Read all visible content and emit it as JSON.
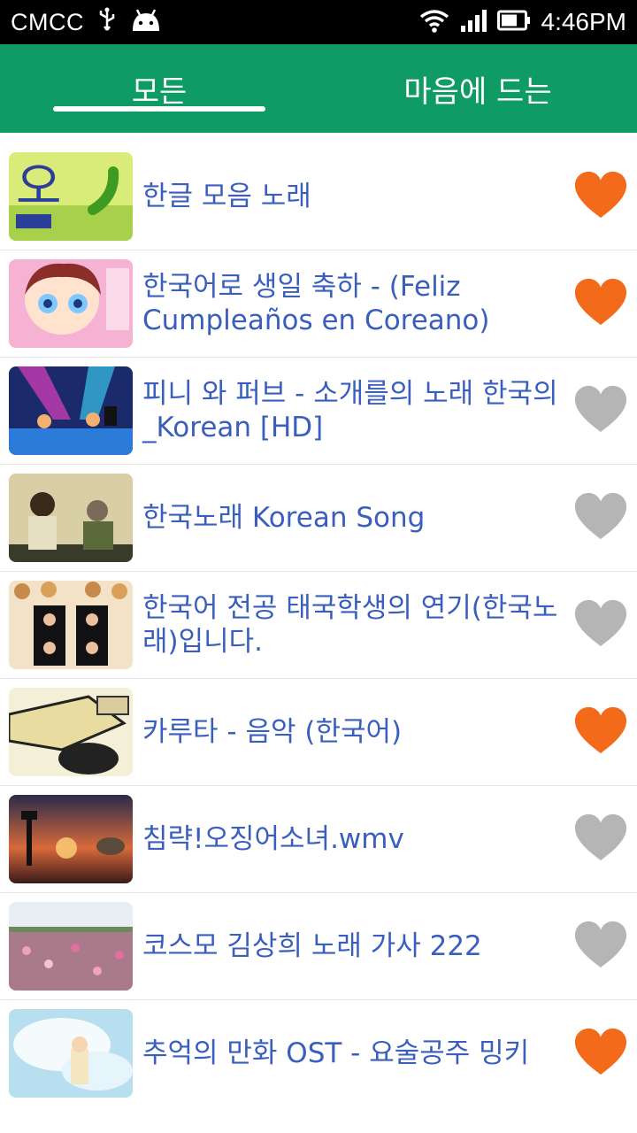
{
  "status_bar": {
    "carrier": "CMCC",
    "time": "4:46PM"
  },
  "tabs": [
    {
      "label": "모든",
      "selected": true
    },
    {
      "label": "마음에 드는",
      "selected": false
    }
  ],
  "colors": {
    "header_green": "#0f9c64",
    "title_blue": "#3a5ebd",
    "heart_favorite": "#f26a1a",
    "heart_default": "#b5b5b5"
  },
  "videos": [
    {
      "title": "한글 모음 노래",
      "favorite": true
    },
    {
      "title": "한국어로 생일 축하 - (Feliz Cumpleaños en Coreano)",
      "favorite": true
    },
    {
      "title": "피니 와 퍼브 - 소개를의 노래 한국의_Korean [HD]",
      "favorite": false
    },
    {
      "title": "한국노래 Korean Song",
      "favorite": false
    },
    {
      "title": "한국어 전공 태국학생의 연기(한국노래)입니다.",
      "favorite": false
    },
    {
      "title": "카루타 - 음악 (한국어)",
      "favorite": true
    },
    {
      "title": "침략!오징어소녀.wmv",
      "favorite": false
    },
    {
      "title": "코스모 김상희 노래 가사 222",
      "favorite": false
    },
    {
      "title": "추억의 만화 OST - 요술공주 밍키",
      "favorite": true
    }
  ]
}
